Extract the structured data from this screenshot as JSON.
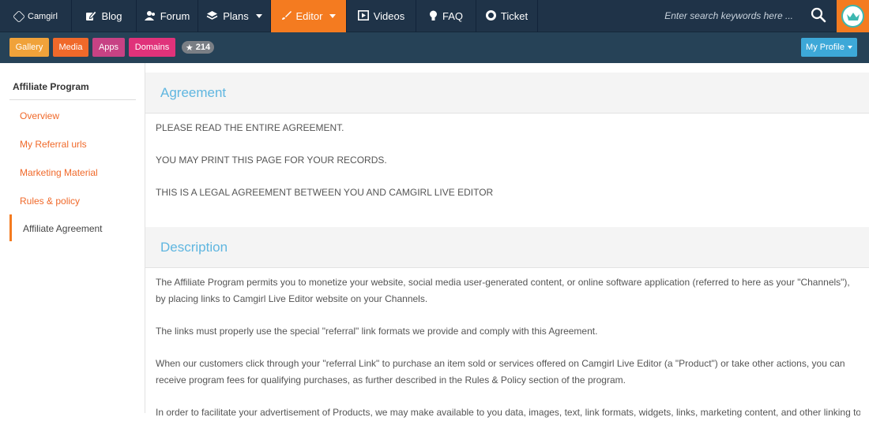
{
  "brand": {
    "name": "Camgirl"
  },
  "nav": {
    "blog": {
      "label": "Blog",
      "icon": "edit-icon"
    },
    "forum": {
      "label": "Forum",
      "icon": "users-icon"
    },
    "plans": {
      "label": "Plans",
      "icon": "layers-icon"
    },
    "editor": {
      "label": "Editor",
      "icon": "brush-icon"
    },
    "videos": {
      "label": "Videos",
      "icon": "play-icon"
    },
    "faq": {
      "label": "FAQ",
      "icon": "bulb-icon"
    },
    "ticket": {
      "label": "Ticket",
      "icon": "lifebuoy-icon"
    }
  },
  "search": {
    "placeholder": "Enter search keywords here ..."
  },
  "subnav": {
    "gallery": "Gallery",
    "media": "Media",
    "apps": "Apps",
    "domains": "Domains",
    "star_count": "214",
    "profile": "My Profile"
  },
  "colors": {
    "nav_bg": "#1f3348",
    "subbar_bg": "#264257",
    "accent_orange": "#f47b20",
    "gallery": "#f0a23a",
    "media": "#f0692a",
    "apps": "#c74284",
    "domains": "#e0327a",
    "profile": "#3da8d8",
    "heading_blue": "#5fb6e0"
  },
  "sidebar": {
    "title": "Affiliate Program",
    "items": [
      {
        "label": "Overview"
      },
      {
        "label": "My Referral urls"
      },
      {
        "label": "Marketing Material"
      },
      {
        "label": "Rules & policy"
      },
      {
        "label": "Affiliate Agreement"
      }
    ]
  },
  "agreement": {
    "title": "Agreement",
    "lines": [
      "PLEASE READ THE ENTIRE AGREEMENT.",
      "YOU MAY PRINT THIS PAGE FOR YOUR RECORDS.",
      "THIS IS A LEGAL AGREEMENT BETWEEN YOU AND CAMGIRL LIVE EDITOR"
    ]
  },
  "description": {
    "title": "Description",
    "paragraphs": [
      "The Affiliate Program permits you to monetize your website, social media user-generated content, or online software application (referred to here as your \"Channels\"), by placing links to Camgirl Live Editor website on your Channels.",
      "The links must properly use the special \"referral\" link formats we provide and comply with this Agreement.",
      "When our customers click through your \"referral Link\" to purchase an item sold or services offered on Camgirl Live Editor (a \"Product\") or take other actions, you can receive program fees for qualifying purchases, as further described in the Rules & Policy section of the program.",
      "In order to facilitate your advertisement of Products, we may make available to you data, images, text, link formats, widgets, links, marketing content, and other linking tools"
    ]
  }
}
